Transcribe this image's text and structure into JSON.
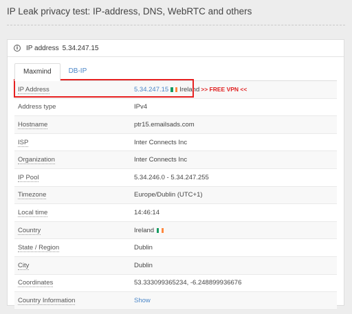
{
  "page": {
    "title": "IP Leak privacy test: IP-address, DNS, WebRTC and others"
  },
  "card": {
    "header_label": "IP address",
    "header_ip": "5.34.247.15"
  },
  "tabs": [
    {
      "label": "Maxmind",
      "active": true
    },
    {
      "label": "DB-IP",
      "active": false
    }
  ],
  "ip_row": {
    "label": "IP Address",
    "ip": "5.34.247.15",
    "country": "Ireland",
    "vpn_text": ">> FREE VPN <<"
  },
  "rows": [
    {
      "label": "Address type",
      "value": "IPv4",
      "underline": false
    },
    {
      "label": "Hostname",
      "value": "ptr15.emailsads.com",
      "underline": true
    },
    {
      "label": "ISP",
      "value": "Inter Connects Inc",
      "underline": true
    },
    {
      "label": "Organization",
      "value": "Inter Connects Inc",
      "underline": true
    },
    {
      "label": "IP Pool",
      "value": "5.34.246.0 - 5.34.247.255",
      "underline": true
    },
    {
      "label": "Timezone",
      "value": "Europe/Dublin (UTC+1)",
      "underline": true
    },
    {
      "label": "Local time",
      "value": "14:46:14",
      "underline": true
    },
    {
      "label": "Country",
      "value": "Ireland",
      "underline": true
    },
    {
      "label": "State / Region",
      "value": "Dublin",
      "underline": true
    },
    {
      "label": "City",
      "value": "Dublin",
      "underline": true
    },
    {
      "label": "Coordinates",
      "value": "53.333099365234, -6.248899936676",
      "underline": true
    },
    {
      "label": "Country Information",
      "value": "Show",
      "underline": true
    }
  ],
  "colors": {
    "link": "#4a86c8",
    "highlight": "#e62020",
    "vpn": "#e02020",
    "flag_ireland": [
      "#169b62",
      "#ffffff",
      "#ff883e"
    ]
  }
}
